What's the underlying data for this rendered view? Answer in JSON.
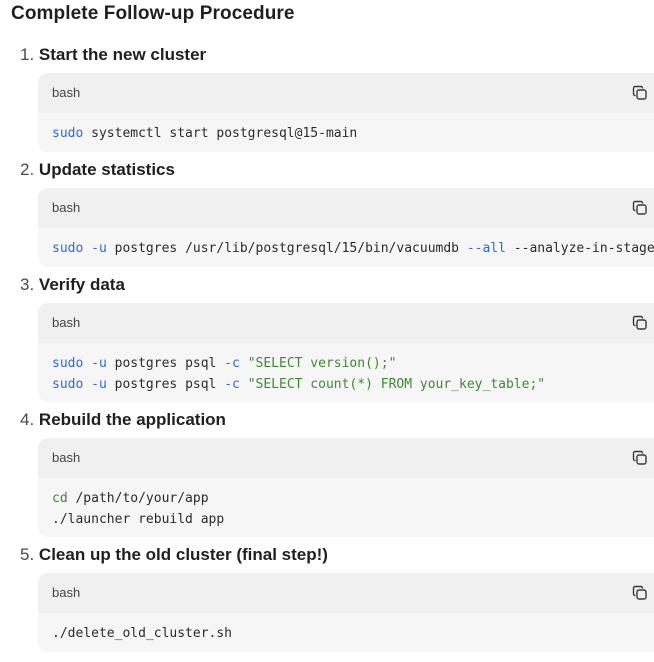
{
  "page": {
    "title": "Complete Follow-up Procedure"
  },
  "icons": {
    "copy": "copy-icon"
  },
  "colors": {
    "command": "#2a6bd6",
    "string": "#3b8a32",
    "code_bg": "#f6f6f6",
    "code_header_bg": "#f0f0f0"
  },
  "steps": [
    {
      "number": "1.",
      "title": "Start the new cluster",
      "lang": "bash",
      "lines": [
        [
          {
            "t": "cmd",
            "v": "sudo"
          },
          {
            "t": "plain",
            "v": " systemctl start postgresql@15-main"
          }
        ]
      ]
    },
    {
      "number": "2.",
      "title": "Update statistics",
      "lang": "bash",
      "lines": [
        [
          {
            "t": "cmd",
            "v": "sudo"
          },
          {
            "t": "plain",
            "v": " "
          },
          {
            "t": "flag",
            "v": "-u"
          },
          {
            "t": "plain",
            "v": " postgres /usr/lib/postgresql/15/bin/vacuumdb "
          },
          {
            "t": "flag",
            "v": "--all"
          },
          {
            "t": "plain",
            "v": " --analyze-in-stages"
          }
        ]
      ]
    },
    {
      "number": "3.",
      "title": "Verify data",
      "lang": "bash",
      "lines": [
        [
          {
            "t": "cmd",
            "v": "sudo"
          },
          {
            "t": "plain",
            "v": " "
          },
          {
            "t": "flag",
            "v": "-u"
          },
          {
            "t": "plain",
            "v": " postgres psql "
          },
          {
            "t": "flag",
            "v": "-c"
          },
          {
            "t": "plain",
            "v": " "
          },
          {
            "t": "str",
            "v": "\"SELECT version();\""
          }
        ],
        [
          {
            "t": "cmd",
            "v": "sudo"
          },
          {
            "t": "plain",
            "v": " "
          },
          {
            "t": "flag",
            "v": "-u"
          },
          {
            "t": "plain",
            "v": " postgres psql "
          },
          {
            "t": "flag",
            "v": "-c"
          },
          {
            "t": "plain",
            "v": " "
          },
          {
            "t": "str",
            "v": "\"SELECT count(*) FROM your_key_table;\""
          }
        ]
      ]
    },
    {
      "number": "4.",
      "title": "Rebuild the application",
      "lang": "bash",
      "lines": [
        [
          {
            "t": "str",
            "v": "cd"
          },
          {
            "t": "plain",
            "v": " /path/to/your/app"
          }
        ],
        [
          {
            "t": "plain",
            "v": "./launcher rebuild app"
          }
        ]
      ]
    },
    {
      "number": "5.",
      "title": "Clean up the old cluster (final step!)",
      "lang": "bash",
      "lines": [
        [
          {
            "t": "plain",
            "v": "./delete_old_cluster.sh"
          }
        ]
      ]
    }
  ]
}
